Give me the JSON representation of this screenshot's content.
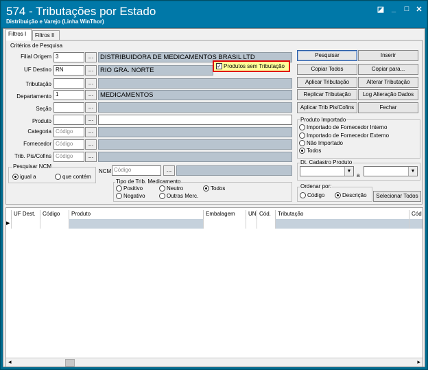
{
  "window": {
    "title": "574 - Tributações por Estado",
    "subtitle": "Distribuição e Varejo (Linha WinThor)",
    "ctl_restore": "◪",
    "ctl_min": "_",
    "ctl_max": "□",
    "ctl_close": "✕"
  },
  "tabs": [
    "Filtros I",
    "Filtros II"
  ],
  "criteria": {
    "legend": "Critérios de Pesquisa",
    "filial_label": "Filial Origem",
    "filial_value": "3",
    "filial_desc": "DISTRIBUIDORA DE MEDICAMENTOS BRASIL LTD",
    "uf_label": "UF Destino",
    "uf_value": "RN",
    "uf_desc": "RIO GRA. NORTE",
    "tributacao_label": "Tributação",
    "tributacao_value": "",
    "tributacao_desc": "",
    "departamento_label": "Departamento",
    "departamento_value": "1",
    "departamento_desc": "MEDICAMENTOS",
    "secao_label": "Seção",
    "secao_value": "",
    "secao_desc": "",
    "produto_label": "Produto",
    "produto_value": "",
    "produto_desc": "",
    "categoria_label": "Categoria",
    "categoria_placeholder": "Código",
    "categoria_desc": "",
    "fornecedor_label": "Fornecedor",
    "fornecedor_placeholder": "Código",
    "fornecedor_desc": "",
    "trib_pis_label": "Trib. Pis/Cofins",
    "trib_pis_placeholder": "Código",
    "trib_pis_desc": "",
    "dots": "...",
    "sem_trib_label": "Produtos sem Tributação",
    "sem_trib_check": "✓"
  },
  "ncm": {
    "legend": "Pesquisar NCM",
    "igual": "igual a",
    "contem": "que contém",
    "label": "NCM",
    "placeholder": "Código",
    "desc": ""
  },
  "trib_med": {
    "legend": "Tipo de Trib. Medicamento",
    "positivo": "Positivo",
    "neutro": "Neutro",
    "todos": "Todos",
    "negativo": "Negativo",
    "outras": "Outras Merc."
  },
  "buttons": {
    "pesquisar": "Pesquisar",
    "inserir": "Inserir",
    "copiar_todos": "Copiar Todos",
    "copiar_para": "Copiar para...",
    "aplicar_trib": "Aplicar Tributação",
    "alterar_trib": "Alterar Tributação",
    "replicar_trib": "Replicar Tributação",
    "log_alt": "Log Alteração Dados",
    "aplicar_pis": "Aplicar Trib Pis/Cofins",
    "fechar": "Fechar",
    "selecionar_todos": "Selecionar Todos"
  },
  "importado": {
    "legend": "Produto Importado",
    "op1": "Importado de Fornecedor Interno",
    "op2": "Importado de Fornecedor Externo",
    "op3": "Não Importado",
    "op4": "Todos"
  },
  "dt_cadastro": {
    "legend": "Dt. Cadastro Produto",
    "a": "a",
    "arrow": "▼"
  },
  "ordenar": {
    "legend": "Ordenar por:",
    "codigo": "Código",
    "descricao": "Descrição"
  },
  "grid": {
    "columns": [
      "UF Dest.",
      "Código",
      "Produto",
      "Embalagem",
      "UN",
      "Cód.",
      "Tributação",
      "Cód"
    ],
    "row_indicator": "▶"
  },
  "scroll": {
    "left": "◂",
    "right": "▸"
  }
}
